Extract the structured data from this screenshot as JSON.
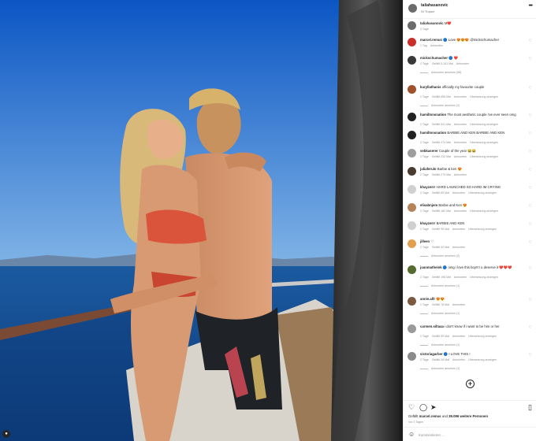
{
  "post": {
    "username": "taliahasanovic",
    "location": "St Tropez",
    "more": "•••"
  },
  "comments": [
    {
      "avatar_color": "#6b6b6b",
      "user": "taliahasanovic",
      "text": "M❤️",
      "meta": [
        "2 Tage"
      ],
      "replies": ""
    },
    {
      "avatar_color": "#c9302c",
      "user": "marcel.remus",
      "text": "🔵 Love 😍😍😍 @mickschumacher",
      "meta": [
        "1 Tag",
        "Antworten"
      ],
      "replies": ""
    },
    {
      "avatar_color": "#3a3a3a",
      "user": "mickschumacher",
      "text": "🔵 ❤️",
      "meta": [
        "2 Tage",
        "Gefällt 5.341 Mal",
        "Antworten"
      ],
      "replies": "Antworten ansehen (98)"
    },
    {
      "avatar_color": "#a0522d",
      "user": "kuryllathanis",
      "text": "officially my favourite couple",
      "meta": [
        "2 Tage",
        "Gefällt 656 Mal",
        "Antworten",
        "Übersetzung anzeigen"
      ],
      "replies": "Antworten ansehen (2)"
    },
    {
      "avatar_color": "#222222",
      "user": "hamiltonsnation",
      "text": "The most aesthetic couple i've ever seen omg",
      "meta": [
        "2 Tage",
        "Gefällt 541 Mal",
        "Antworten",
        "Übersetzung anzeigen"
      ],
      "replies": ""
    },
    {
      "avatar_color": "#222222",
      "user": "hamiltonsnation",
      "text": "BARBIE AND KEN BARBIE AND KEN",
      "meta": [
        "2 Tage",
        "Gefällt 474 Mal",
        "Antworten",
        "Übersetzung anzeigen"
      ],
      "replies": ""
    },
    {
      "avatar_color": "#9e9e9e",
      "user": "sebkaserer",
      "text": "Couple of the year 😂😂",
      "meta": [
        "2 Tage",
        "Gefällt 232 Mal",
        "Antworten",
        "Übersetzung anzeigen"
      ],
      "replies": ""
    },
    {
      "avatar_color": "#4a3b2f",
      "user": "juliaferulo",
      "text": "Barbie & ken 😍",
      "meta": [
        "2 Tage",
        "Gefällt 279 Mal",
        "Antworten"
      ],
      "replies": ""
    },
    {
      "avatar_color": "#d0d0d0",
      "user": "khayzerrr",
      "text": "HARD LAUNCHED SO HARD IM CRYING",
      "meta": [
        "2 Tage",
        "Gefällt 85 Mal",
        "Antworten",
        "Übersetzung anzeigen"
      ],
      "replies": ""
    },
    {
      "avatar_color": "#b5835a",
      "user": "elisabnjem",
      "text": "Barbie and Ken 😍",
      "meta": [
        "2 Tage",
        "Gefällt 182 Mal",
        "Antworten",
        "Übersetzung anzeigen"
      ],
      "replies": ""
    },
    {
      "avatar_color": "#d0d0d0",
      "user": "khayzerrr",
      "text": "BARBIE AND KEN",
      "meta": [
        "2 Tage",
        "Gefällt 90 Mal",
        "Antworten",
        "Übersetzung anzeigen"
      ],
      "replies": ""
    },
    {
      "avatar_color": "#e0a050",
      "user": "jilleen",
      "text": "♡",
      "meta": [
        "2 Tage",
        "Gefällt 32 Mal",
        "Antworten"
      ],
      "replies": "Antworten ansehen (2)"
    },
    {
      "avatar_color": "#556b2f",
      "user": "juanmatheink",
      "text": "🔵 omg i love this boy!!!! u deserve it ❤️❤️❤️",
      "meta": [
        "2 Tage",
        "Gefällt 196 Mal",
        "Antworten",
        "Übersetzung anzeigen"
      ],
      "replies": "Antworten ansehen (1)"
    },
    {
      "avatar_color": "#7a5a40",
      "user": "annie.alfr",
      "text": "😍😍",
      "meta": [
        "2 Tage",
        "Gefällt 76 Mal",
        "Antworten"
      ],
      "replies": "Antworten ansehen (1)"
    },
    {
      "avatar_color": "#9a9a9a",
      "user": "carmen.siltaaa",
      "text": "i don't know if i want to be him or her",
      "meta": [
        "2 Tage",
        "Gefällt 59 Mal",
        "Antworten",
        "Übersetzung anzeigen"
      ],
      "replies": "Antworten ansehen (1)"
    },
    {
      "avatar_color": "#8a8a8a",
      "user": "victoriagarber",
      "text": "🔵 I LOVE THIS !",
      "meta": [
        "2 Tage",
        "Gefällt 28 Mal",
        "Antworten",
        "Übersetzung anzeigen"
      ],
      "replies": "Antworten ansehen (1)"
    }
  ],
  "load_more": "+",
  "actions": {
    "like_icon": "heart-icon",
    "comment_icon": "comment-icon",
    "share_icon": "share-icon",
    "save_icon": "bookmark-icon"
  },
  "likes": {
    "prefix": "Gefällt",
    "user": "marcel.remus",
    "suffix": "und",
    "count": "39.096 weitere Personen"
  },
  "date": "Vor 2 Tagen",
  "comment_input": {
    "placeholder": "Kommentieren ..."
  }
}
